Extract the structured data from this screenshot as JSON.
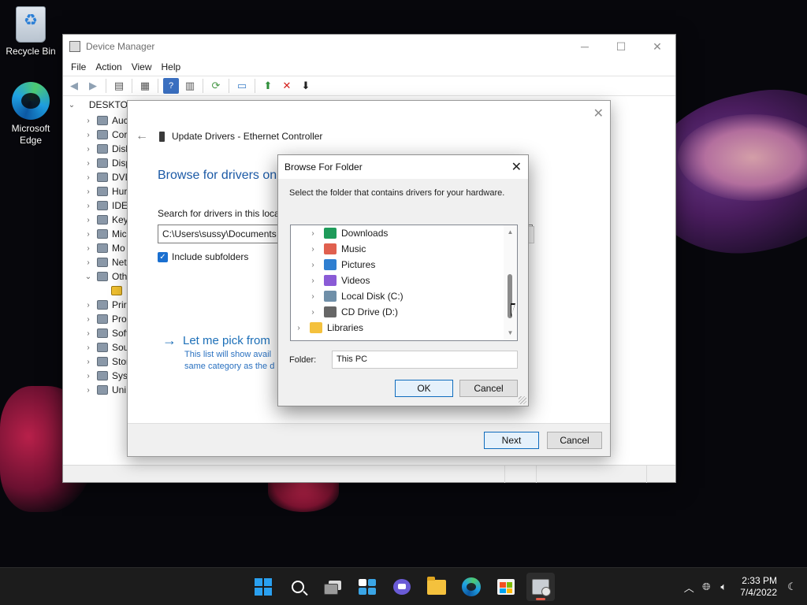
{
  "desktop": {
    "icons": [
      {
        "label": "Recycle Bin"
      },
      {
        "label": "Microsoft Edge"
      }
    ]
  },
  "device_manager": {
    "title": "Device Manager",
    "menu": [
      "File",
      "Action",
      "View",
      "Help"
    ],
    "tree": {
      "root": "DESKTO",
      "items": [
        "Auc",
        "Cor",
        "Disk",
        "Disp",
        "DVD",
        "Hur",
        "IDE",
        "Key",
        "Mic",
        "Mo",
        "Net",
        "Oth",
        "",
        "Prir",
        "Pro",
        "Soft",
        "Sou",
        "Stor",
        "Syst",
        "Uni"
      ]
    }
  },
  "update_wizard": {
    "header": "Update Drivers - Ethernet Controller",
    "heading": "Browse for drivers on",
    "search_label": "Search for drivers in this locat",
    "path_value": "C:\\Users\\sussy\\Documents",
    "include_subfolders": "Include subfolders",
    "pick_title": "Let me pick from",
    "pick_desc_1": "This list will show avail",
    "pick_desc_2": "same category as the d",
    "next": "Next",
    "cancel": "Cancel"
  },
  "browse_for_folder": {
    "title": "Browse For Folder",
    "instruction": "Select the folder that contains drivers for your hardware.",
    "tree": [
      {
        "label": "Downloads",
        "icon": "download-icon",
        "color": "#1e9b5a"
      },
      {
        "label": "Music",
        "icon": "music-icon",
        "color": "#e0604f"
      },
      {
        "label": "Pictures",
        "icon": "pictures-icon",
        "color": "#2f7fd1"
      },
      {
        "label": "Videos",
        "icon": "videos-icon",
        "color": "#8a5bd6"
      },
      {
        "label": "Local Disk (C:)",
        "icon": "drive-icon",
        "color": "#6f8fa8"
      },
      {
        "label": "CD Drive (D:)",
        "icon": "cd-drive-icon",
        "color": "#666666"
      },
      {
        "label": "Libraries",
        "icon": "folder-icon",
        "color": "#f4c13d"
      }
    ],
    "folder_label": "Folder:",
    "folder_value": "This PC",
    "ok": "OK",
    "cancel": "Cancel"
  },
  "taskbar": {
    "time": "2:33 PM",
    "date": "7/4/2022",
    "apps": [
      "start-icon",
      "search-icon",
      "task-view-icon",
      "widgets-icon",
      "chat-icon",
      "file-explorer-icon",
      "edge-icon",
      "store-icon",
      "device-manager-icon"
    ]
  },
  "colors": {
    "accent": "#0f6cbd",
    "link": "#1c6fb8",
    "taskbar": "#1c1c1c"
  }
}
